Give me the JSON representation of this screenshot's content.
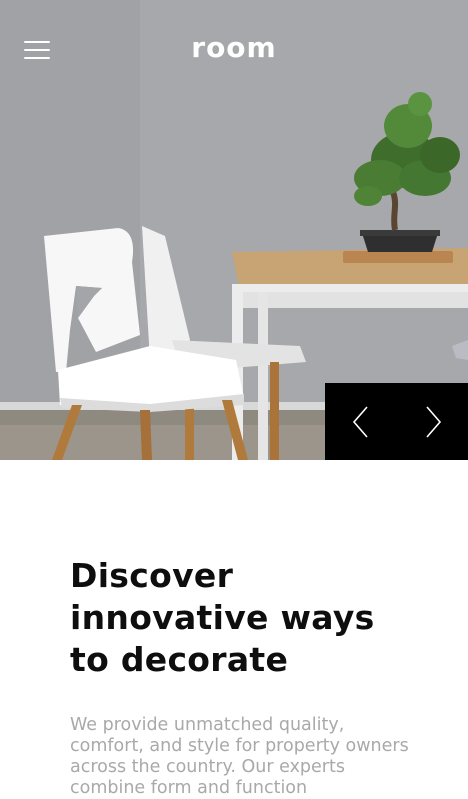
{
  "header": {
    "menu_icon": "hamburger-menu-icon",
    "logo": "room"
  },
  "slider": {
    "prev_icon": "chevron-left-icon",
    "next_icon": "chevron-right-icon"
  },
  "main": {
    "headline": "Discover innovative ways to decorate",
    "description": "We provide unmatched quality, comfort, and style for property owners across the country. Our experts combine form and function"
  }
}
